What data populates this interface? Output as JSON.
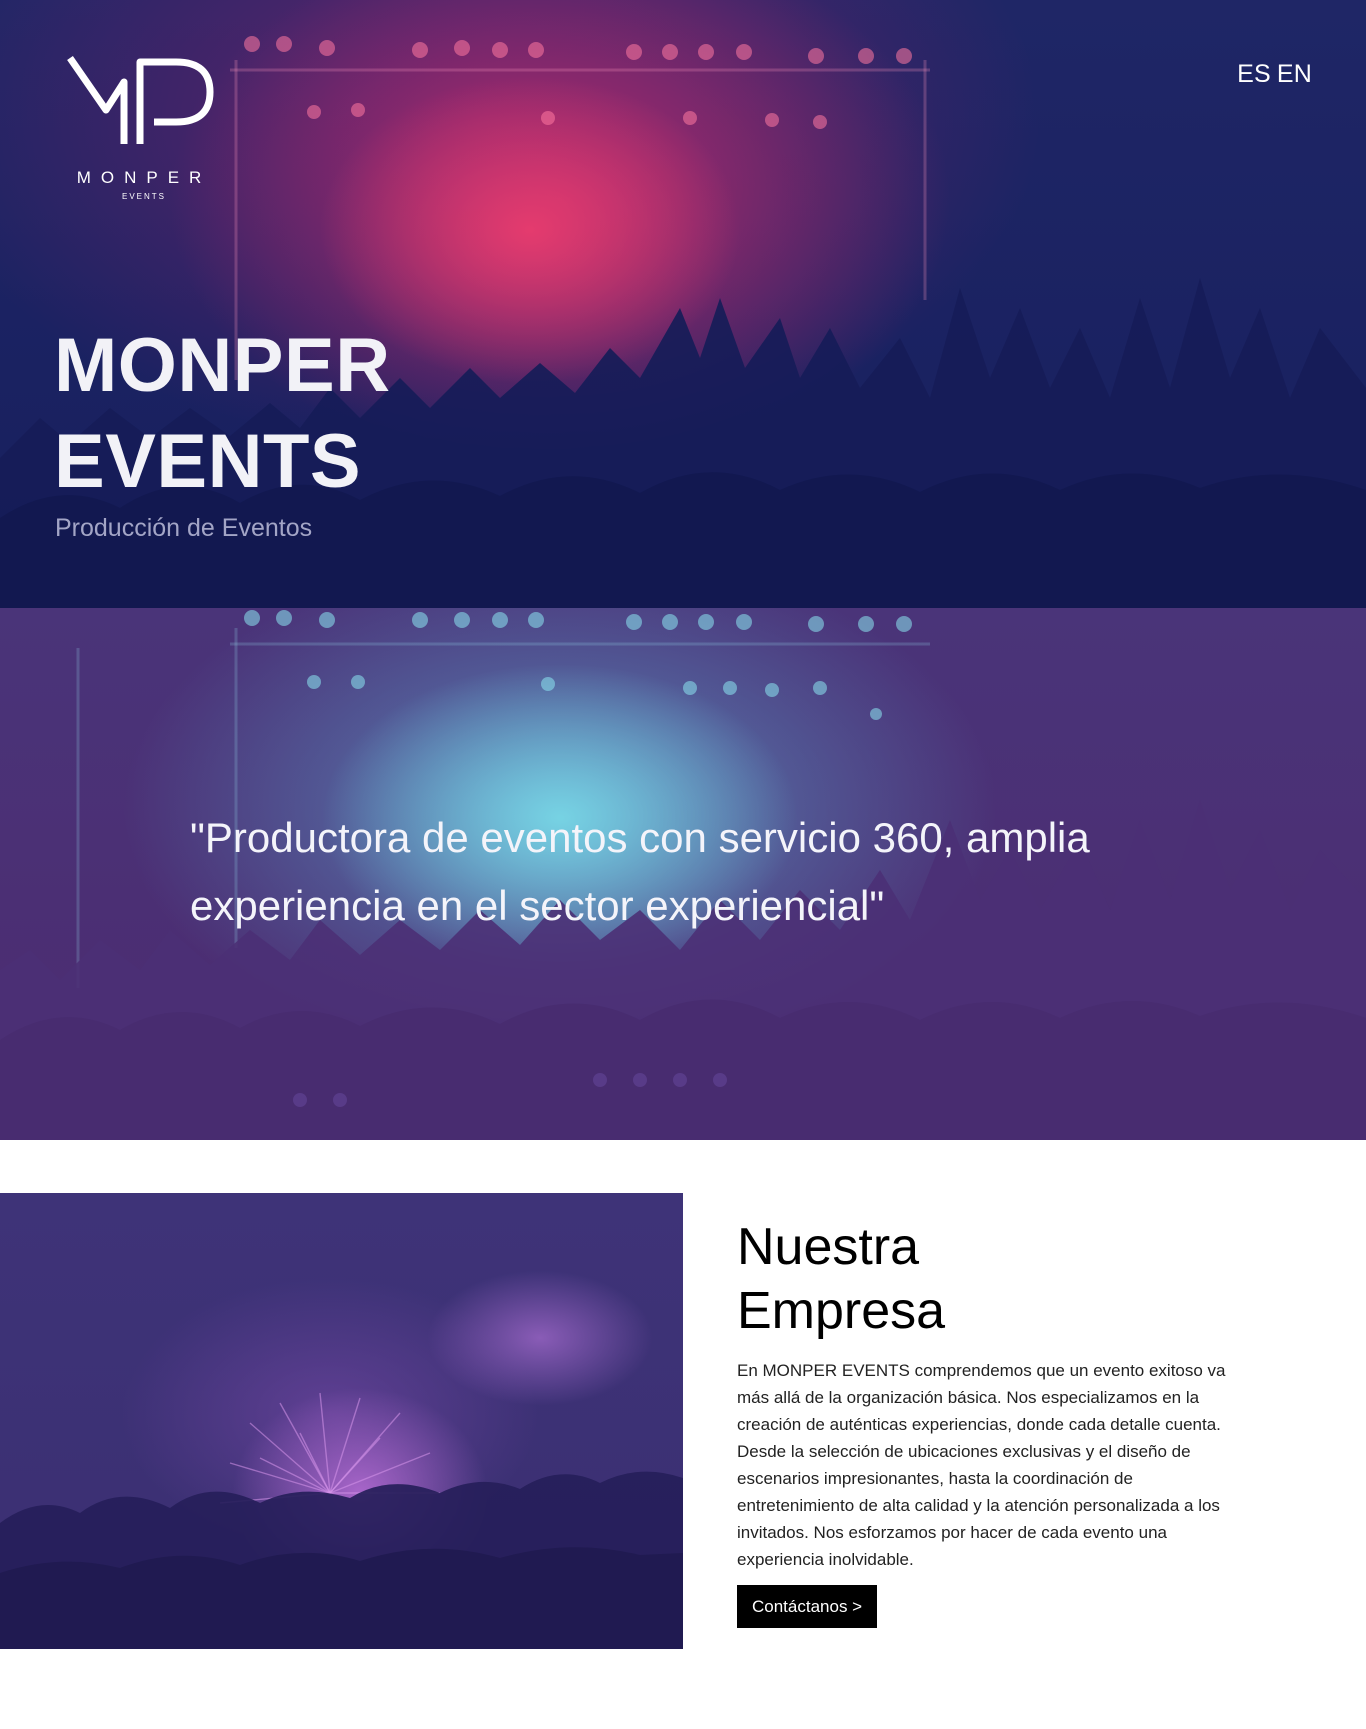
{
  "header": {
    "logo": {
      "monogram": "MP",
      "brand": "MONPER",
      "tagline": "EVENTS"
    },
    "languages": [
      "ES",
      "EN"
    ]
  },
  "hero": {
    "title_line1": "MONPER",
    "title_line2": "EVENTS",
    "subtitle": "Producción de Eventos"
  },
  "quote_band": {
    "text": "\"Productora de eventos con servicio 360, amplia experiencia en el sector experiencial\""
  },
  "company": {
    "title_line1": "Nuestra",
    "title_line2": "Empresa",
    "body": "En MONPER EVENTS comprendemos que un evento exitoso va más allá de la organización básica. Nos especializamos en la creación de auténticas experiencias, donde cada detalle cuenta. Desde la selección de ubicaciones exclusivas y el diseño de escenarios impresionantes, hasta la coordinación de entretenimiento de alta calidad y la atención personalizada a los invitados. Nos esforzamos por hacer de cada evento una experiencia inolvidable.",
    "cta_label": "Contáctanos >"
  },
  "colors": {
    "hero_navy": "#1a2262",
    "hero_pink": "#e03c6e",
    "band_purple": "#4b2f75",
    "band_cyan": "#78d7e6",
    "company_purple": "#3d3276",
    "cta_black": "#000000"
  }
}
